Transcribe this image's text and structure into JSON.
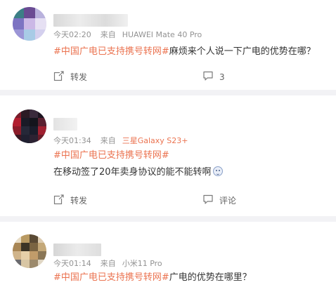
{
  "posts": [
    {
      "time": "今天02:20",
      "source_prefix": "来自",
      "source": "HUAWEI Mate 40 Pro",
      "topic": "#中国广电已支持携号转网#",
      "text": "麻烦来个人说一下广电的优势在哪？",
      "repost_label": "转发",
      "comment_count": "3"
    },
    {
      "time": "今天01:34",
      "source_prefix": "来自",
      "source": "三星Galaxy S23+",
      "topic": "#中国广电已支持携号转网#",
      "text": "在移动签了20年卖身协议的能不能转啊",
      "emoji_icon": "crying-face-icon",
      "repost_label": "转发",
      "comment_label": "评论"
    },
    {
      "time": "今天01:14",
      "source_prefix": "来自",
      "source": "小米11 Pro",
      "topic": "#中国广电已支持携号转网#",
      "text": "广电的优势在哪里？"
    }
  ],
  "colors": {
    "topic": "#eb7350",
    "meta": "#939393",
    "text": "#333333",
    "divider": "#f2f2f5"
  },
  "icons": {
    "repost": "repost-icon",
    "comment": "comment-icon"
  }
}
